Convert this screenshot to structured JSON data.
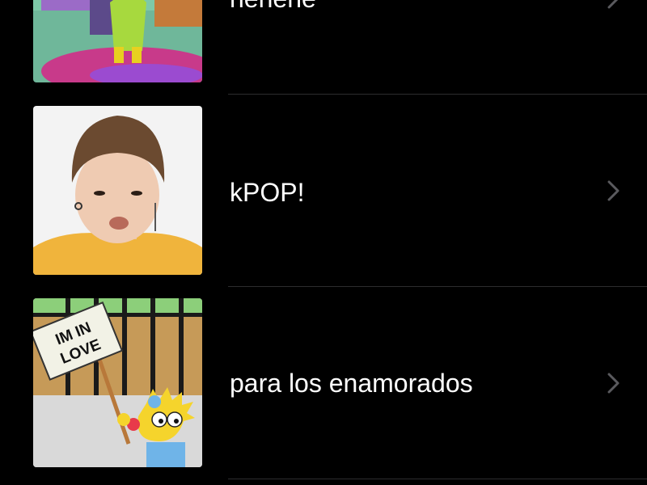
{
  "theme": {
    "background": "#000000",
    "text_color": "#ffffff",
    "chevron_color": "#5a5a5e",
    "separator_color": "#2c2c2e"
  },
  "list": {
    "items": [
      {
        "label": "hehehe",
        "thumbnail": "cartoon-dancing-character-thumbnail",
        "icon": "chevron-right-icon"
      },
      {
        "label": "kPOP!",
        "thumbnail": "kpop-singer-face-thumbnail",
        "icon": "chevron-right-icon"
      },
      {
        "label": "para los enamorados",
        "thumbnail": "cartoon-baby-im-in-love-sign-thumbnail",
        "sign_text": "IM IN LOVE",
        "icon": "chevron-right-icon"
      }
    ]
  }
}
